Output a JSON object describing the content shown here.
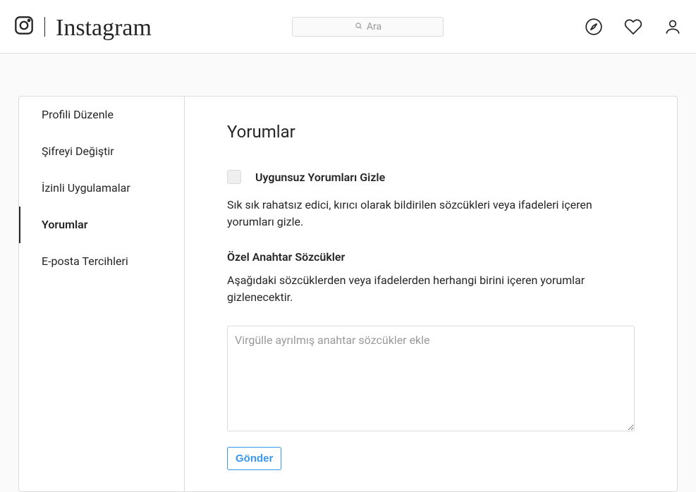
{
  "header": {
    "brand": "Instagram",
    "search_placeholder": "Ara"
  },
  "sidebar": {
    "items": [
      {
        "label": "Profili Düzenle",
        "active": false
      },
      {
        "label": "Şifreyi Değiştir",
        "active": false
      },
      {
        "label": "İzinli Uygulamalar",
        "active": false
      },
      {
        "label": "Yorumlar",
        "active": true
      },
      {
        "label": "E-posta Tercihleri",
        "active": false
      }
    ]
  },
  "content": {
    "title": "Yorumlar",
    "hide_checkbox_label": "Uygunsuz Yorumları Gizle",
    "hide_description": "Sık sık rahatsız edici, kırıcı olarak bildirilen sözcükleri veya ifadeleri içeren yorumları gizle.",
    "keywords_title": "Özel Anahtar Sözcükler",
    "keywords_description": "Aşağıdaki sözcüklerden veya ifadelerden herhangi birini içeren yorumlar gizlenecektir.",
    "keywords_placeholder": "Virgülle ayrılmış anahtar sözcükler ekle",
    "submit_label": "Gönder"
  }
}
